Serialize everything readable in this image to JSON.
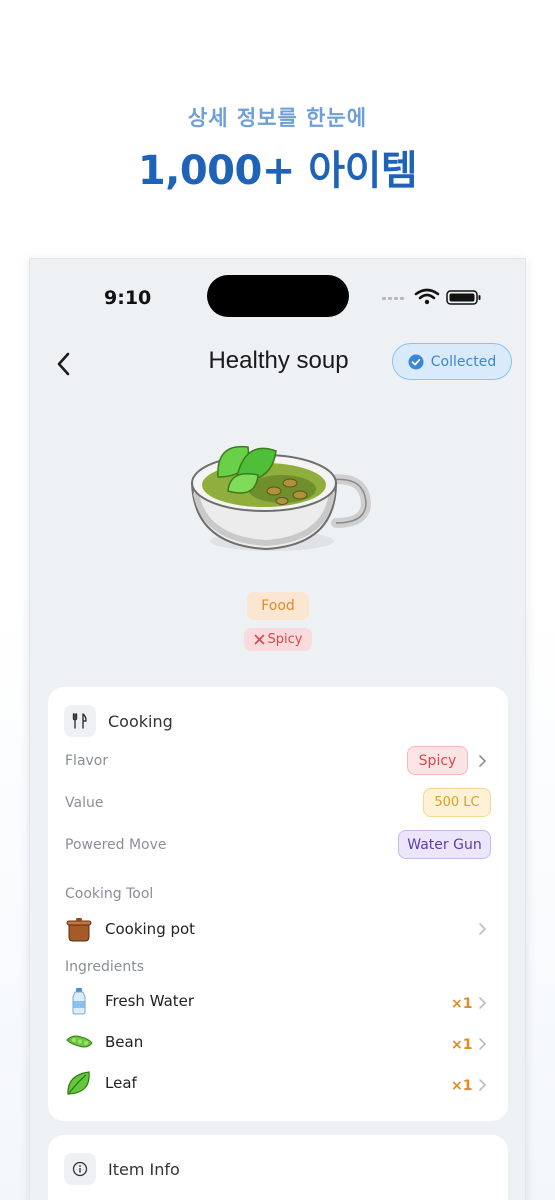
{
  "promo": {
    "subtitle": "상세 정보를 한눈에",
    "title": "1,000+ 아이템"
  },
  "status_bar": {
    "time": "9:10"
  },
  "nav": {
    "title": "Healthy soup",
    "collected_label": "Collected"
  },
  "tags": {
    "category": "Food",
    "flavor": "Spicy"
  },
  "cooking": {
    "section_title": "Cooking",
    "flavor_label": "Flavor",
    "flavor_value": "Spicy",
    "value_label": "Value",
    "value_value": "500 LC",
    "move_label": "Powered Move",
    "move_value": "Water Gun",
    "tool_label": "Cooking Tool",
    "tool_name": "Cooking pot",
    "ingredients_label": "Ingredients",
    "ingredients": [
      {
        "name": "Fresh Water",
        "qty": "×1",
        "icon": "water-bottle-icon"
      },
      {
        "name": "Bean",
        "qty": "×1",
        "icon": "bean-icon"
      },
      {
        "name": "Leaf",
        "qty": "×1",
        "icon": "leaf-icon"
      }
    ]
  },
  "item_info": {
    "section_title": "Item Info"
  },
  "colors": {
    "promo_title": "#1f63b8",
    "promo_sub": "#6f9fd6",
    "collected": "#3b86d6",
    "spicy": "#d9484e",
    "food": "#e48a2a",
    "value": "#d6a02a",
    "move": "#5d3ab3",
    "qty": "#e28a24"
  }
}
